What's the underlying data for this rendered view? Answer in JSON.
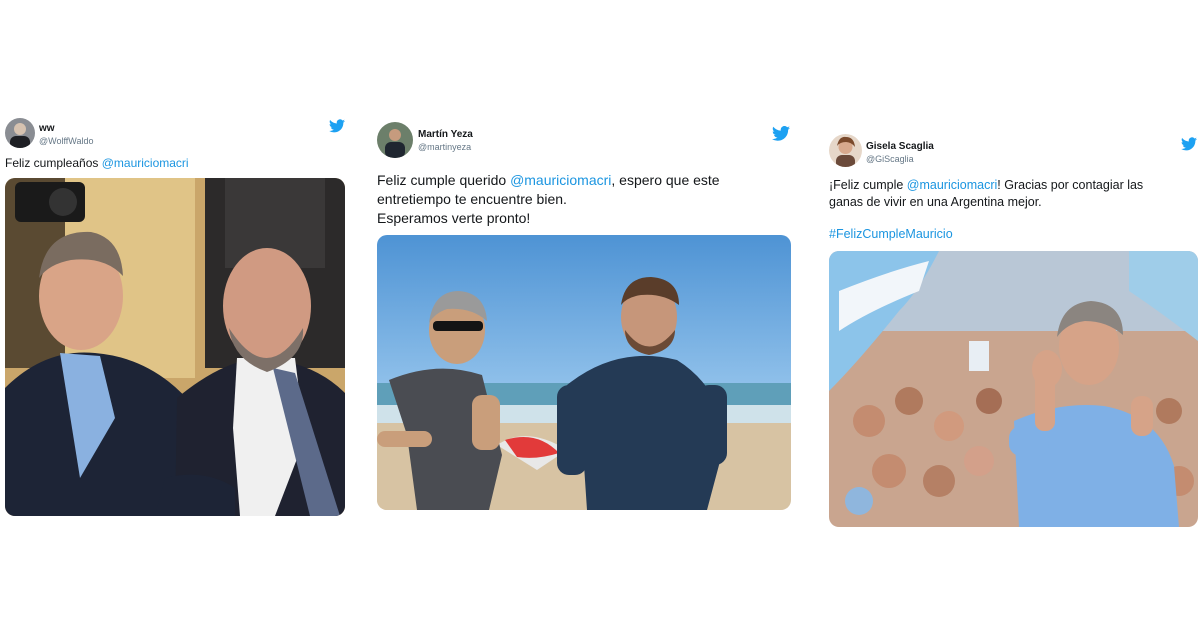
{
  "tweets": [
    {
      "name": "ww",
      "handle": "@WolffWaldo",
      "text_before": "Feliz cumpleaños ",
      "mention": "@mauriciomacri",
      "text_after": "",
      "line2": "",
      "line3": "",
      "hashtag": ""
    },
    {
      "name": "Martín Yeza",
      "handle": "@martinyeza",
      "text_before": "Feliz cumple querido ",
      "mention": "@mauriciomacri",
      "text_after": ", espero que este",
      "line2": "entretiempo te encuentre bien.",
      "line3": "Esperamos verte pronto!",
      "hashtag": ""
    },
    {
      "name": "Gisela Scaglia",
      "handle": "@GiScaglia",
      "text_before": "¡Feliz cumple ",
      "mention": "@mauriciomacri",
      "text_after": "! Gracias por contagiar las",
      "line2": "ganas de vivir en una Argentina mejor.",
      "line3": "",
      "hashtag": "#FelizCumpleMauricio"
    }
  ],
  "colors": {
    "twitter_blue": "#1da1f2",
    "link_blue": "#1b95e0",
    "text": "#14171a",
    "muted": "#657786"
  },
  "icons": {
    "brand": "twitter-bird-icon"
  }
}
